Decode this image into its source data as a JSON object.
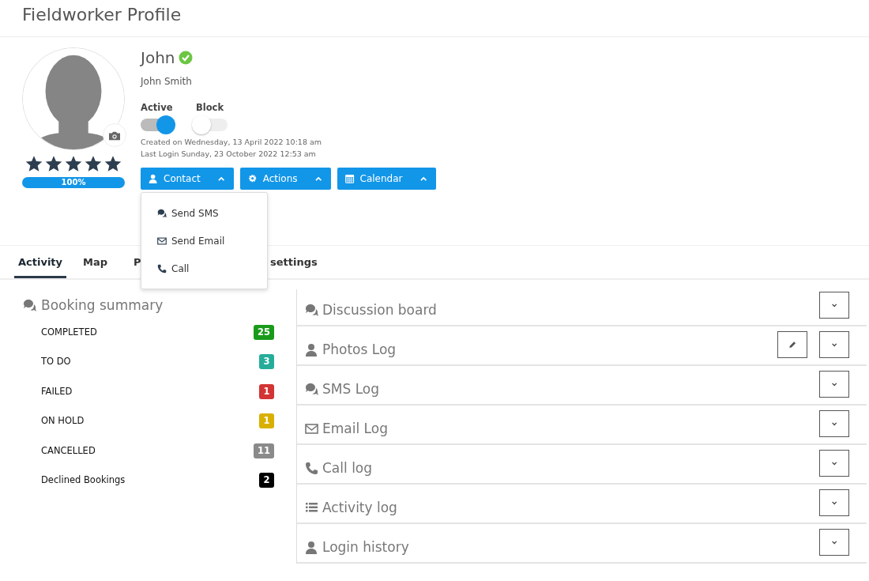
{
  "page_title": "Fieldworker Profile",
  "profile": {
    "display_name": "John",
    "verified": true,
    "full_name": "John Smith",
    "stars": 5,
    "completion": {
      "level": 1,
      "reading": "100%"
    },
    "toggles": [
      {
        "label": "Active",
        "on": true
      },
      {
        "label": "Block",
        "on": false
      }
    ],
    "created": "Created on Wednesday, 13 April 2022 10:18 am",
    "last_login": "Last Login Sunday, 23 October 2022 12:53 am",
    "buttons": [
      {
        "label": "Contact",
        "menu": [
          "Send SMS",
          "Send Email",
          "Call"
        ]
      },
      {
        "label": "Actions"
      },
      {
        "label": "Calendar"
      }
    ]
  },
  "tabs": [
    {
      "label": "Activity",
      "selected": true
    },
    {
      "label": "Map",
      "selected": false
    },
    {
      "label": "P",
      "selected": false
    },
    {
      "label": "settings",
      "selected": false
    }
  ],
  "booking_summary": {
    "title": "Booking summary",
    "items": [
      {
        "label": "COMPLETED",
        "count": "25",
        "color": "#1a9a1a"
      },
      {
        "label": "TO DO",
        "count": "3",
        "color": "#26ad9a"
      },
      {
        "label": "FAILED",
        "count": "1",
        "color": "#d33434"
      },
      {
        "label": "ON HOLD",
        "count": "1",
        "color": "#d9b000"
      },
      {
        "label": "CANCELLED",
        "count": "11",
        "color": "#8a8a8a"
      },
      {
        "label": "Declined Bookings",
        "count": "2",
        "color": "#000000"
      }
    ]
  },
  "panels": [
    {
      "title": "Discussion board",
      "editable": false
    },
    {
      "title": "Photos Log",
      "editable": true
    },
    {
      "title": "SMS Log",
      "editable": false
    },
    {
      "title": "Email Log",
      "editable": false
    },
    {
      "title": "Call log",
      "editable": false
    },
    {
      "title": "Activity log",
      "editable": false
    },
    {
      "title": "Login history",
      "editable": false
    }
  ]
}
